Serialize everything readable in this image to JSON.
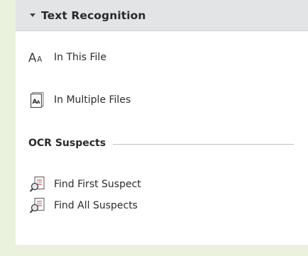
{
  "panel": {
    "section_title": "Text Recognition",
    "items": [
      {
        "label": "In This File",
        "icon": "text-size-icon"
      },
      {
        "label": "In Multiple Files",
        "icon": "document-text-icon"
      }
    ],
    "subsection": {
      "title": "OCR Suspects",
      "items": [
        {
          "label": "Find First Suspect",
          "icon": "find-suspect-icon"
        },
        {
          "label": "Find All Suspects",
          "icon": "find-suspects-icon"
        }
      ]
    }
  },
  "colors": {
    "background": "#eaf2de",
    "header_bg": "#e3e4e6",
    "text": "#2b2b2b",
    "rule": "#bdbdbd"
  }
}
